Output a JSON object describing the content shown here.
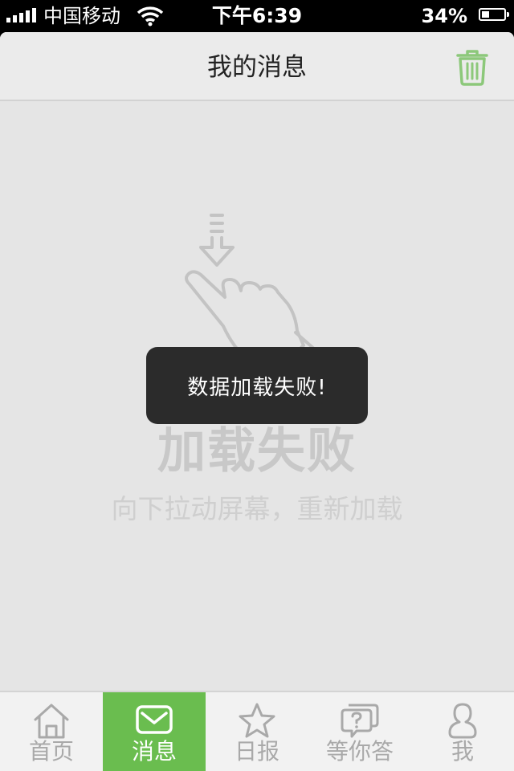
{
  "status_bar": {
    "carrier": "中国移动",
    "time": "下午6:39",
    "battery": "34%",
    "battery_level": 0.34
  },
  "nav": {
    "title": "我的消息",
    "trash_icon": "trash-icon"
  },
  "empty_state": {
    "illustration_icon": "pull-down-hand-icon",
    "title": "加载失败",
    "hint": "向下拉动屏幕，重新加载"
  },
  "toast": {
    "message": "数据加载失败!"
  },
  "tab_bar": {
    "active_color": "#6abd4f",
    "items": [
      {
        "label": "首页",
        "icon": "home-icon"
      },
      {
        "label": "消息",
        "icon": "envelope-icon",
        "active": true
      },
      {
        "label": "日报",
        "icon": "star-icon"
      },
      {
        "label": "等你答",
        "icon": "question-chat-icon"
      },
      {
        "label": "我",
        "icon": "user-icon"
      }
    ]
  }
}
